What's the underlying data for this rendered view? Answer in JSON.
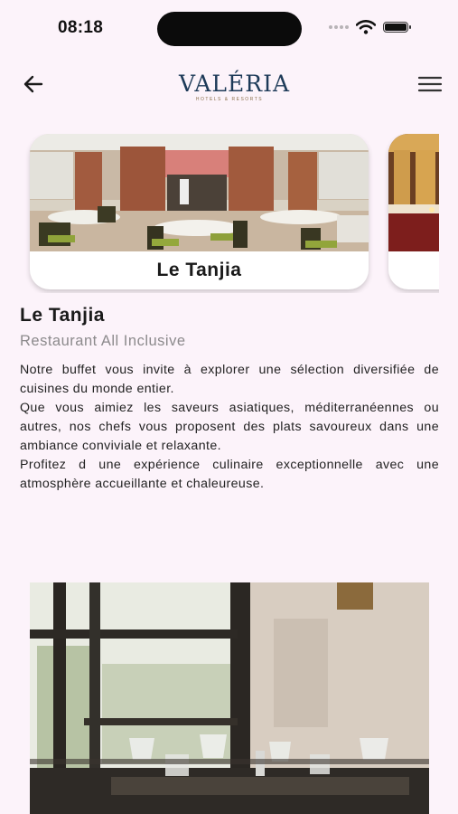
{
  "status_bar": {
    "time": "08:18"
  },
  "header": {
    "logo_main": "VALÉRIA",
    "logo_sub": "HOTELS & RESORTS"
  },
  "carousel": {
    "cards": [
      {
        "label": "Le Tanjia"
      },
      {
        "label": ""
      }
    ]
  },
  "restaurant": {
    "name": "Le Tanjia",
    "category": "Restaurant All Inclusive",
    "description": [
      "Notre buffet vous invite à explorer une sélection diversifiée de cuisines du monde entier.",
      "Que vous aimiez les saveurs asiatiques, méditerranéennes ou autres, nos chefs vous proposent des plats savoureux dans une ambiance conviviale et relaxante.",
      "Profitez d une expérience culinaire exceptionnelle avec une atmosphère accueillante et chaleureuse."
    ]
  },
  "icons": [
    "back-arrow-icon",
    "hamburger-menu-icon",
    "wifi-icon",
    "battery-icon",
    "cellular-signal-icon"
  ],
  "colors": {
    "background": "#fcf3fa",
    "logo_blue": "#1d3a58",
    "logo_gold": "#8a6f4b",
    "subtitle_gray": "#8c8a8c"
  }
}
